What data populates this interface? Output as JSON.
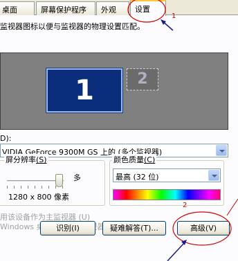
{
  "tabs": [
    {
      "label": "桌面",
      "active": false
    },
    {
      "label": "屏幕保护程序",
      "active": false
    },
    {
      "label": "外观",
      "active": false
    },
    {
      "label": "设置",
      "active": true
    }
  ],
  "instruction": "监视器图标以便与监视器的物理设置匹配。",
  "monitors": {
    "primary": "1",
    "secondary": "2"
  },
  "display": {
    "label": "D):",
    "value": "VIDIA GeForce 9300M GS 上的 (多个监视器)"
  },
  "resolution": {
    "title": "屏分辨率",
    "hotkey": "(S)",
    "more_label": "多",
    "value": "1280 x 800 像素",
    "slider_level": 1.0
  },
  "color_quality": {
    "title": "颜色质量",
    "hotkey": "(C)",
    "value": "最高 (32 位)"
  },
  "checkboxes": {
    "primary": "用该设备作为主监视器 (U)",
    "extend": "Windows 桌面扩展到该监视器上 (E)"
  },
  "buttons": {
    "identify": "识别(I)",
    "troubleshoot": "疑难解答(T)...",
    "advanced": "高级(V)"
  },
  "annotations": {
    "step1": "1",
    "step2": "2",
    "color": "#d40000",
    "arrow_color": "#1a1a8c"
  }
}
